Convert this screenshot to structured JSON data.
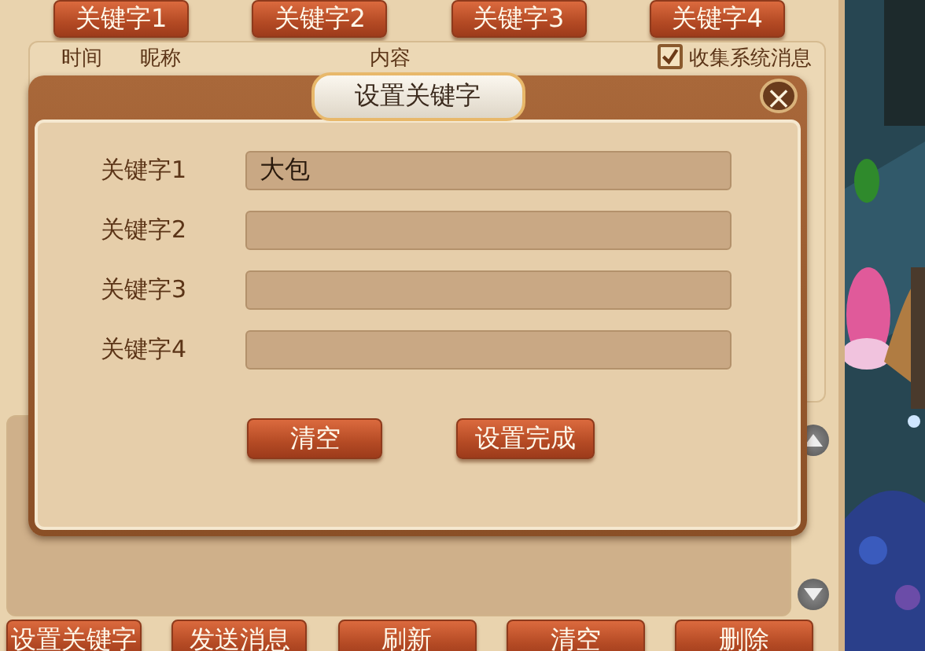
{
  "top_buttons": [
    "关键字1",
    "关键字2",
    "关键字3",
    "关键字4"
  ],
  "message_list": {
    "columns": [
      "时间",
      "昵称",
      "内容"
    ],
    "collect_system": {
      "label": "收集系统消息",
      "checked": true
    }
  },
  "bottom_buttons": [
    "设置关键字",
    "发送消息",
    "刷新",
    "清空",
    "删除"
  ],
  "dialog": {
    "title": "设置关键字",
    "close": "×",
    "fields": [
      {
        "label": "关键字1",
        "value": "大包"
      },
      {
        "label": "关键字2"
      },
      {
        "label": "关键字3"
      },
      {
        "label": "关键字4"
      }
    ],
    "buttons": [
      "清空",
      "设置完成"
    ]
  },
  "scene": {
    "kind": "picture"
  }
}
